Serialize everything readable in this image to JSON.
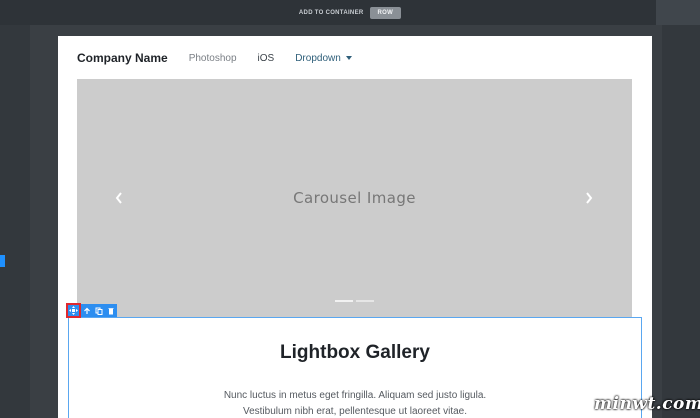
{
  "toolbar": {
    "add_to_container": "ADD TO CONTAINER",
    "row_button": "ROW"
  },
  "navbar": {
    "brand": "Company Name",
    "links": [
      "Photoshop",
      "iOS",
      "Dropdown"
    ]
  },
  "carousel": {
    "caption": "Carousel Image",
    "slide_count": 2,
    "active_slide": 1
  },
  "row_tools": {
    "icons": [
      "move-icon",
      "arrow-up-icon",
      "copy-icon",
      "trash-icon"
    ]
  },
  "gallery": {
    "title": "Lightbox Gallery",
    "line1": "Nunc luctus in metus eget fringilla. Aliquam sed justo ligula.",
    "line2": "Vestibulum nibh erat, pellentesque ut laoreet vitae."
  },
  "watermark": "minwt.com",
  "colors": {
    "selection": "#2d8ef0",
    "highlight": "#e0282e",
    "carousel_bg": "#cccccc"
  }
}
